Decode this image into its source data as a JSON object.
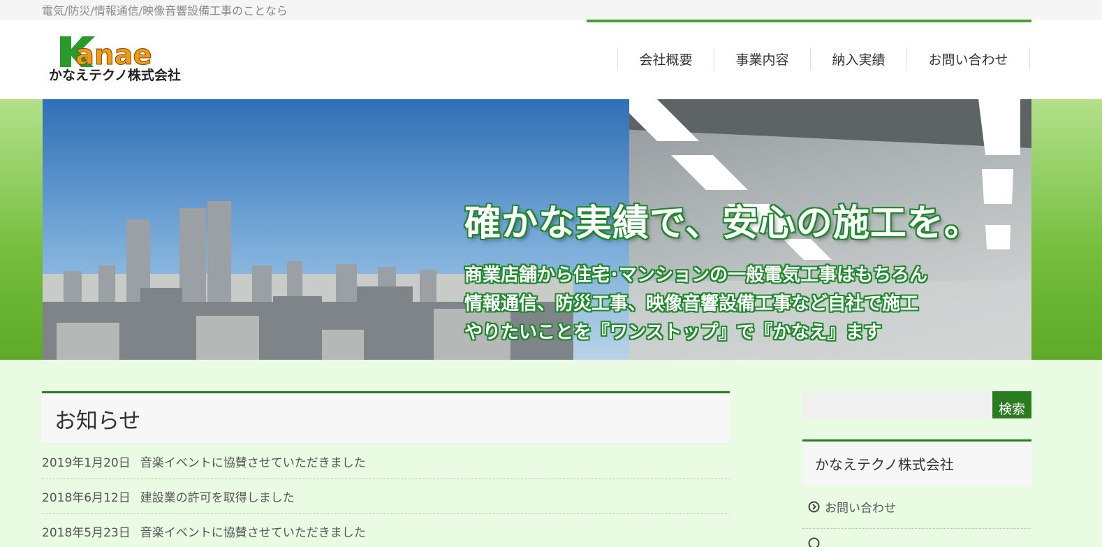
{
  "topbar": {
    "tagline": "電気/防災/情報通信/映像音響設備工事のことなら"
  },
  "header": {
    "logo": {
      "wordmark": "Kanae",
      "company": "かなえテクノ株式会社"
    },
    "nav": [
      {
        "label": "会社概要"
      },
      {
        "label": "事業内容"
      },
      {
        "label": "納入実績"
      },
      {
        "label": "お問い合わせ"
      }
    ],
    "accent_color": "#4aa02a"
  },
  "hero": {
    "headline": "確かな実績で、安心の施工を。",
    "lines": [
      "商業店舗から住宅･マンションの一般電気工事はもちろん",
      "情報通信、防災工事、映像音響設備工事など自社で施工",
      "やりたいことを『ワンストップ』で『かなえ』ます"
    ]
  },
  "news": {
    "heading": "お知らせ",
    "items": [
      {
        "date": "2019年1月20日",
        "title": "音楽イベントに協賛させていただきました"
      },
      {
        "date": "2018年6月12日",
        "title": "建設業の許可を取得しました"
      },
      {
        "date": "2018年5月23日",
        "title": "音楽イベントに協賛させていただきました"
      }
    ]
  },
  "sidebar": {
    "search": {
      "button_label": "検索",
      "placeholder": ""
    },
    "widget": {
      "heading": "かなえテクノ株式会社",
      "links": [
        {
          "label": "お問い合わせ"
        }
      ]
    },
    "brand_color": "#2a7d1f"
  }
}
